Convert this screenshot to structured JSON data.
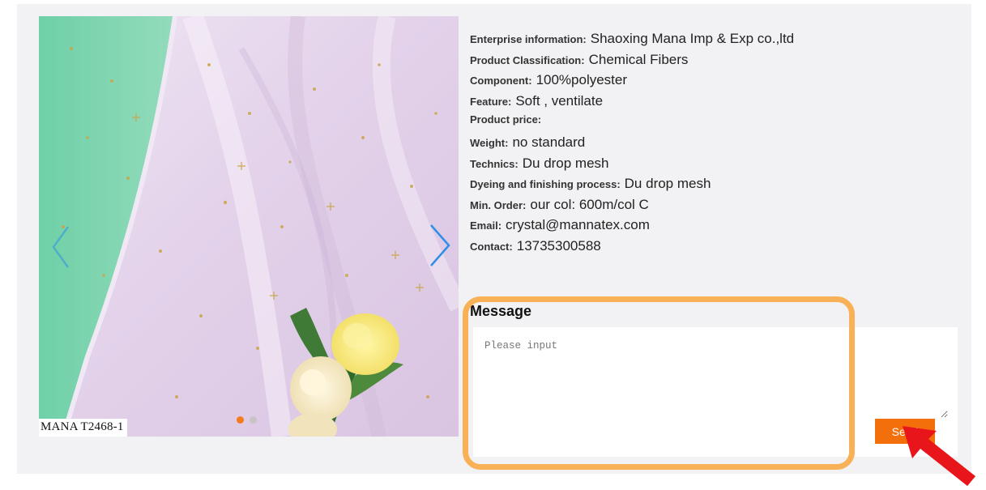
{
  "product": {
    "image_caption": "MANA T2468-1",
    "carousel": {
      "slides": 2,
      "active": 0,
      "prev_icon": "chevron-left",
      "next_icon": "chevron-right"
    },
    "info": [
      {
        "key": "enterprise",
        "label": "Enterprise information",
        "sep": ":",
        "value": "Shaoxing Mana Imp & Exp co.,ltd"
      },
      {
        "key": "classification",
        "label": "Product Classification",
        "sep": ":",
        "value": "Chemical Fibers"
      },
      {
        "key": "component",
        "label": "Component",
        "sep": ":",
        "value": "100%polyester"
      },
      {
        "key": "feature",
        "label": "Feature",
        "sep": ":",
        "value": "Soft , ventilate"
      },
      {
        "key": "price",
        "label": "Product price",
        "sep": ":",
        "value": ""
      },
      {
        "key": "weight",
        "label": "Weight",
        "sep": ":",
        "value": "no standard"
      },
      {
        "key": "technics",
        "label": "Technics",
        "sep": ":",
        "value": "Du drop mesh"
      },
      {
        "key": "dyeing",
        "label": "Dyeing and finishing process",
        "sep": ":",
        "value": "Du drop mesh"
      },
      {
        "key": "min_order",
        "label": "Min. Order",
        "sep": ":",
        "value": "our col: 600m/col C"
      },
      {
        "key": "email",
        "label": "Email",
        "sep": ":",
        "value": "crystal@mannatex.com"
      },
      {
        "key": "contact",
        "label": "Contact",
        "sep": ":",
        "value": "13735300588"
      }
    ]
  },
  "message": {
    "title": "Message",
    "placeholder": "Please input",
    "value": "",
    "send_label": "Send"
  },
  "colors": {
    "accent": "#f36f0b",
    "dot_active": "#f37b1d",
    "highlight": "#f8b157",
    "arrow": "#e8161b",
    "carousel_arrow": "#2f8fe6"
  }
}
